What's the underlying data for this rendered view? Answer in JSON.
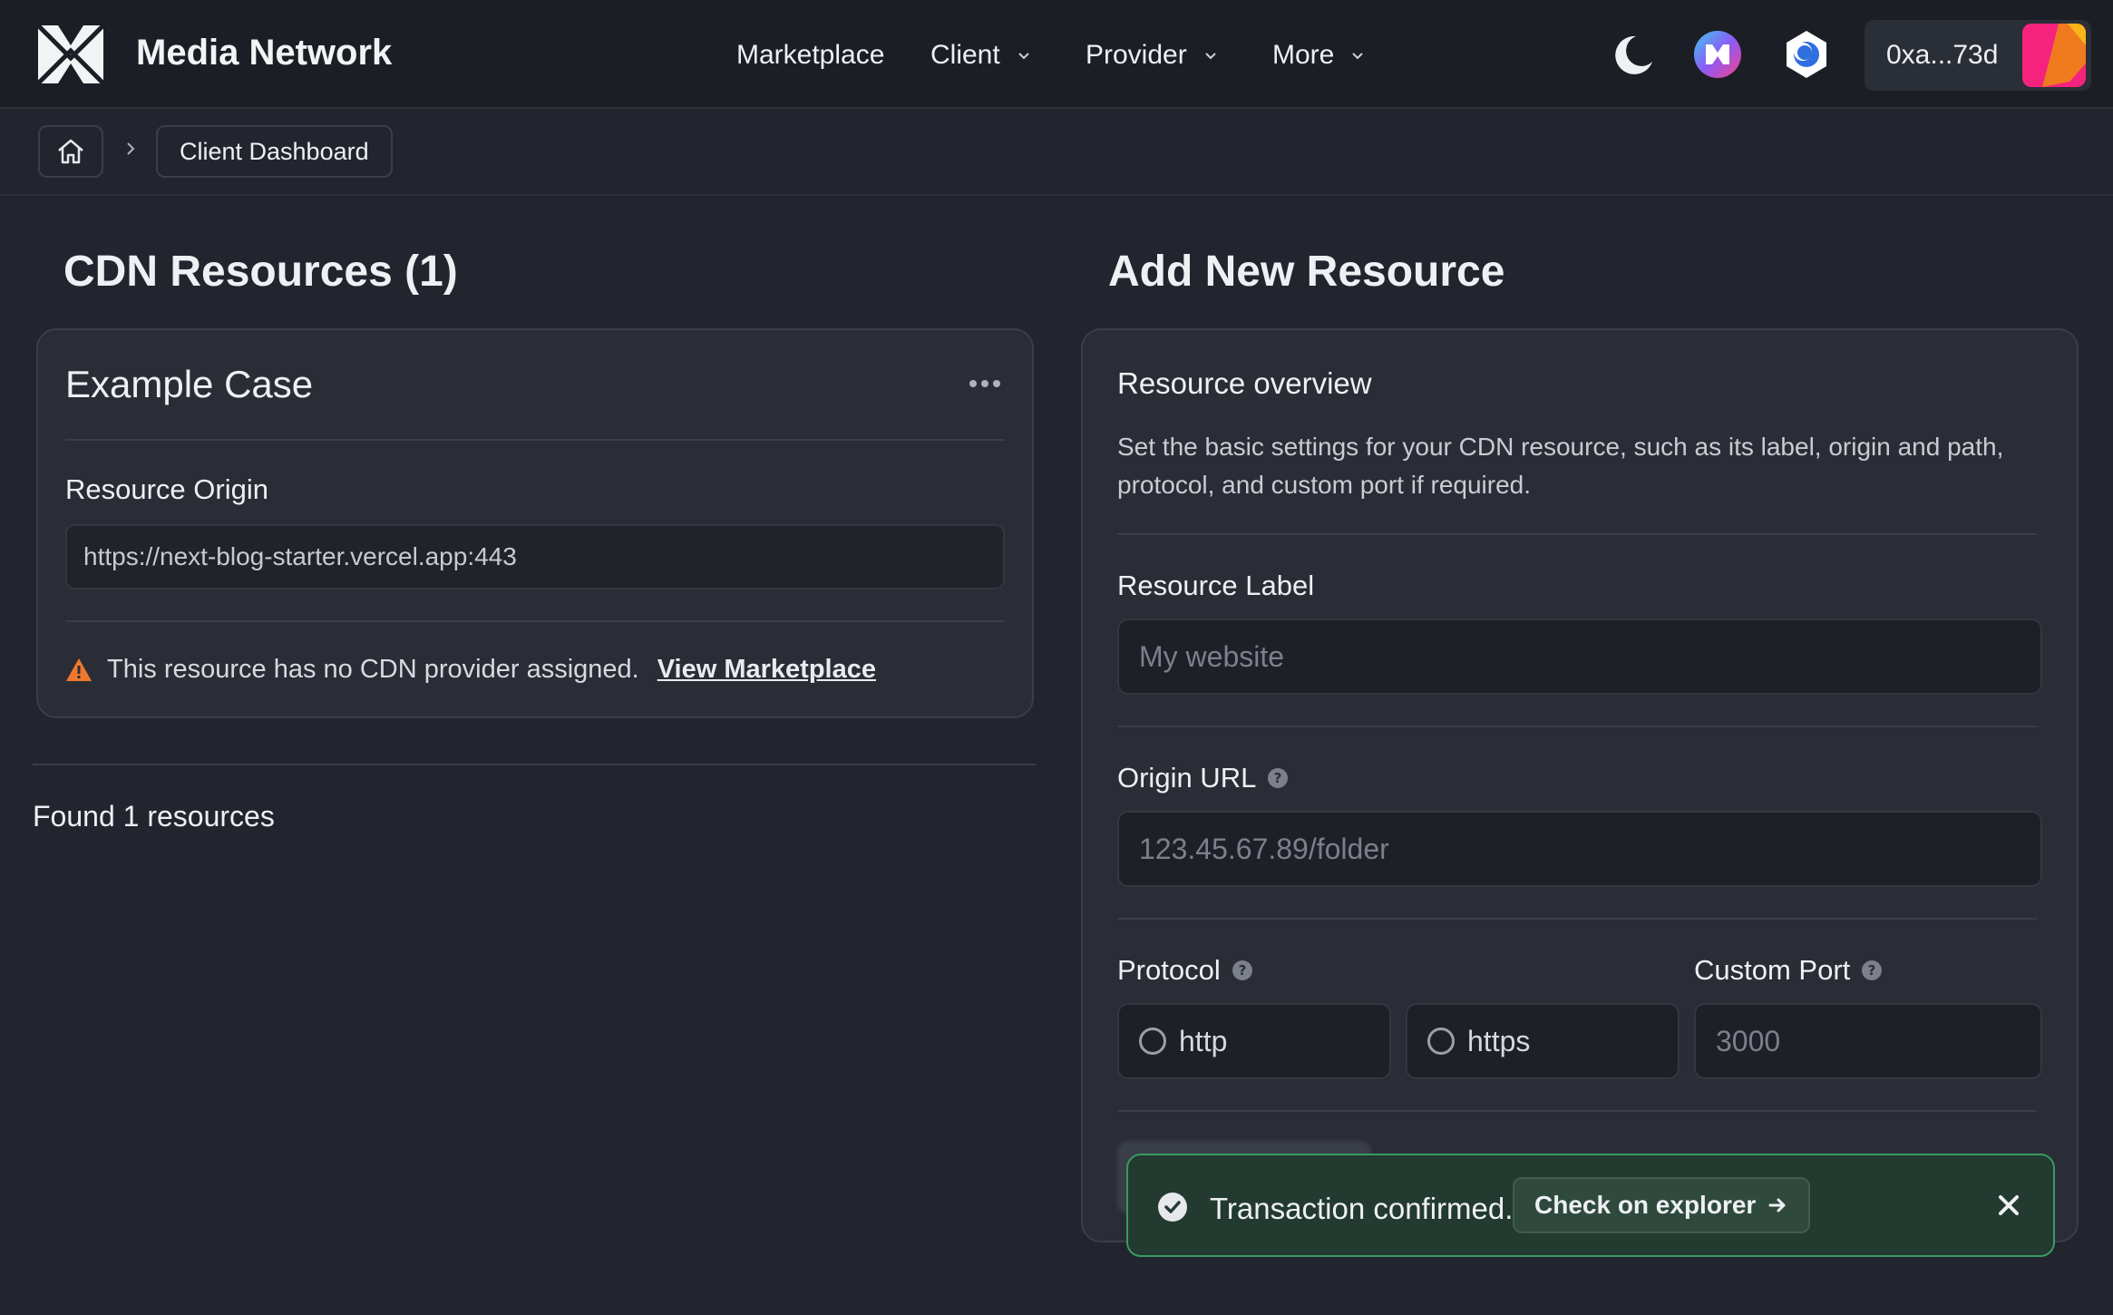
{
  "navbar": {
    "brand": "Media Network",
    "links": [
      {
        "label": "Marketplace",
        "has_dropdown": false
      },
      {
        "label": "Client",
        "has_dropdown": true
      },
      {
        "label": "Provider",
        "has_dropdown": true
      },
      {
        "label": "More",
        "has_dropdown": true
      }
    ],
    "icons": [
      "moon-icon",
      "media-network-token-icon",
      "network-chain-icon"
    ],
    "wallet_address": "0xa...73d"
  },
  "breadcrumb": {
    "current": "Client Dashboard"
  },
  "resources": {
    "title": "CDN Resources (1)",
    "card": {
      "title": "Example Case",
      "origin_label": "Resource Origin",
      "origin_value": "https://next-blog-starter.vercel.app:443",
      "warning_text": "This resource has no CDN provider assigned.",
      "warning_link": "View Marketplace"
    },
    "found_text": "Found 1 resources"
  },
  "add_resource": {
    "title": "Add New Resource",
    "overview_title": "Resource overview",
    "overview_desc": "Set the basic settings for your CDN resource, such as its label, origin and path, protocol, and custom port if required.",
    "label_field": {
      "label": "Resource Label",
      "placeholder": "My website"
    },
    "origin_field": {
      "label": "Origin URL",
      "placeholder": "123.45.67.89/folder"
    },
    "protocol": {
      "label": "Protocol",
      "options": [
        "http",
        "https"
      ]
    },
    "port_field": {
      "label": "Custom Port",
      "placeholder": "3000"
    }
  },
  "toast": {
    "message": "Transaction confirmed.",
    "link_label": "Check on explorer"
  },
  "colors": {
    "background": "#22252e",
    "navbar": "#1b1e25",
    "card": "#2a2d35",
    "success_border": "#3a9a62",
    "warning": "#f0782d"
  }
}
